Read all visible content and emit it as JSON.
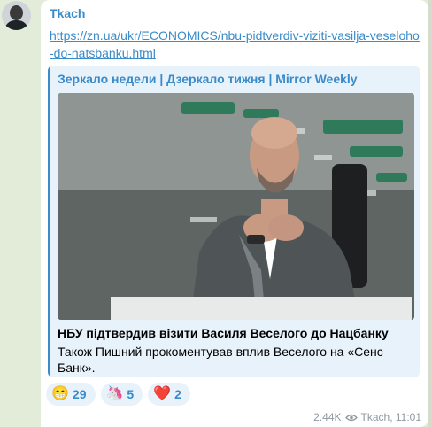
{
  "message": {
    "sender": "Tkach",
    "link_text": "https://zn.ua/ukr/ECONOMICS/nbu-pidtverdiv-viziti-vasilja-veseloho-do-natsbanku.html",
    "preview": {
      "site_name": "Зеркало недели | Дзеркало тижня | Mirror Weekly",
      "title": "НБУ підтвердив візити Василя Веселого до Нацбанку",
      "description": "Також Пишний прокоментував вплив Веселого на «Сенс Банк»."
    },
    "reactions": [
      {
        "emoji": "😁",
        "icon": "grinning-face-icon",
        "count": "29"
      },
      {
        "emoji": "🦄",
        "icon": "unicorn-icon",
        "count": "5"
      },
      {
        "emoji": "❤️",
        "icon": "red-heart-icon",
        "count": "2"
      }
    ],
    "views": "2.44K",
    "author_signature": "Tkach, 11:01"
  },
  "colors": {
    "accent": "#3a8bc9",
    "chat_background": "#e3ebd9",
    "preview_background": "#e8f2fb",
    "meta_text": "#8e99a3"
  }
}
